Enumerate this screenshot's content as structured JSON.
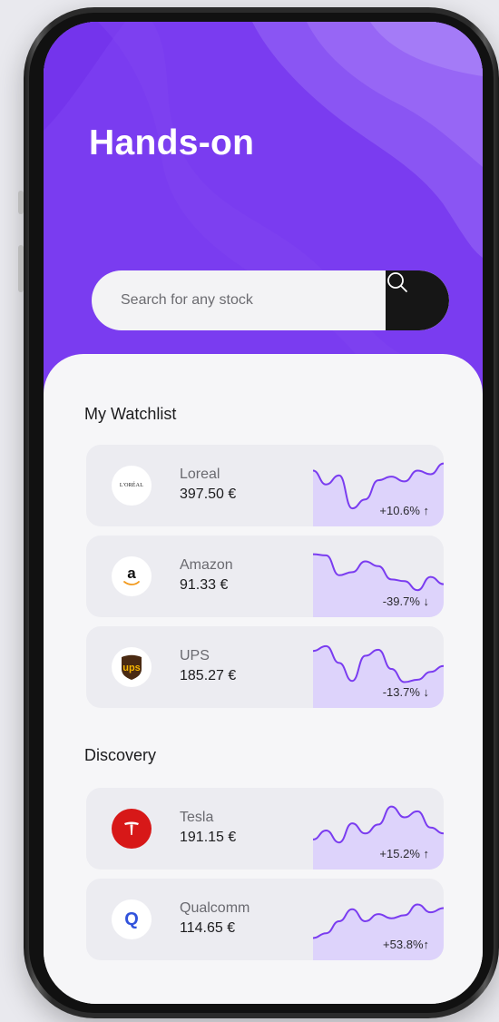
{
  "app": {
    "title": "Hands-on"
  },
  "search": {
    "placeholder": "Search for any stock"
  },
  "watchlist": {
    "title": "My Watchlist",
    "items": [
      {
        "name": "Loreal",
        "price": "397.50 €",
        "change": "+10.6% ↑",
        "logo_text": "L'ORÉAL",
        "logo_icon": "loreal-logo",
        "trend": [
          0.78,
          0.55,
          0.7,
          0.15,
          0.3,
          0.62,
          0.68,
          0.6,
          0.78,
          0.72,
          0.9
        ]
      },
      {
        "name": "Amazon",
        "price": "91.33 €",
        "change": "-39.7% ↓",
        "logo_text": "a",
        "logo_icon": "amazon-logo",
        "trend": [
          0.9,
          0.88,
          0.55,
          0.6,
          0.78,
          0.7,
          0.48,
          0.45,
          0.3,
          0.52,
          0.4
        ]
      },
      {
        "name": "UPS",
        "price": "185.27 €",
        "change": "-13.7% ↓",
        "logo_text": "ups",
        "logo_icon": "ups-logo",
        "trend": [
          0.8,
          0.88,
          0.6,
          0.3,
          0.72,
          0.82,
          0.5,
          0.28,
          0.32,
          0.45,
          0.55
        ]
      }
    ]
  },
  "discovery": {
    "title": "Discovery",
    "items": [
      {
        "name": "Tesla",
        "price": "191.15 €",
        "change": "+15.2% ↑",
        "logo_text": "T",
        "logo_icon": "tesla-logo",
        "trend": [
          0.35,
          0.5,
          0.3,
          0.62,
          0.45,
          0.6,
          0.9,
          0.72,
          0.82,
          0.55,
          0.45
        ]
      },
      {
        "name": "Qualcomm",
        "price": "114.65 €",
        "change": "+53.8%↑",
        "logo_text": "Q",
        "logo_icon": "qualcomm-logo",
        "trend": [
          0.22,
          0.3,
          0.5,
          0.7,
          0.5,
          0.62,
          0.55,
          0.6,
          0.78,
          0.65,
          0.72
        ]
      }
    ]
  },
  "colors": {
    "brand_purple": "#7a3cf0",
    "chart_line": "#7a3cf0",
    "chart_fill": "#ddd3fb",
    "search_button": "#161616"
  }
}
